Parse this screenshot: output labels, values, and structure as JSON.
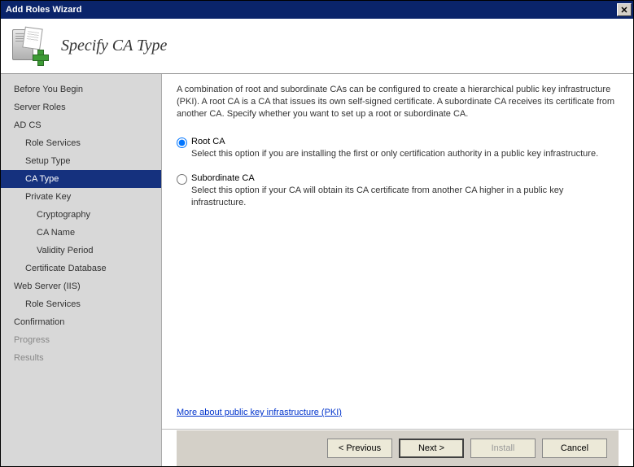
{
  "window": {
    "title": "Add Roles Wizard"
  },
  "header": {
    "title": "Specify CA Type"
  },
  "sidebar": {
    "items": [
      {
        "label": "Before You Begin",
        "level": 0,
        "selected": false
      },
      {
        "label": "Server Roles",
        "level": 0,
        "selected": false
      },
      {
        "label": "AD CS",
        "level": 0,
        "selected": false
      },
      {
        "label": "Role Services",
        "level": 1,
        "selected": false
      },
      {
        "label": "Setup Type",
        "level": 1,
        "selected": false
      },
      {
        "label": "CA Type",
        "level": 1,
        "selected": true
      },
      {
        "label": "Private Key",
        "level": 1,
        "selected": false
      },
      {
        "label": "Cryptography",
        "level": 2,
        "selected": false
      },
      {
        "label": "CA Name",
        "level": 2,
        "selected": false
      },
      {
        "label": "Validity Period",
        "level": 2,
        "selected": false
      },
      {
        "label": "Certificate Database",
        "level": 1,
        "selected": false
      },
      {
        "label": "Web Server (IIS)",
        "level": 0,
        "selected": false
      },
      {
        "label": "Role Services",
        "level": 1,
        "selected": false
      },
      {
        "label": "Confirmation",
        "level": 0,
        "selected": false
      },
      {
        "label": "Progress",
        "level": 0,
        "selected": false,
        "disabled": true
      },
      {
        "label": "Results",
        "level": 0,
        "selected": false,
        "disabled": true
      }
    ]
  },
  "content": {
    "description": "A combination of root and subordinate CAs can be configured to create a hierarchical public key infrastructure (PKI). A root CA is a CA that issues its own self-signed certificate. A subordinate CA receives its certificate from another CA. Specify whether you want to set up a root or subordinate CA.",
    "options": [
      {
        "title": "Root CA",
        "desc": "Select this option if you are installing the first or only certification authority in a public key infrastructure.",
        "checked": true
      },
      {
        "title": "Subordinate CA",
        "desc": "Select this option if your CA will obtain its CA certificate from another CA higher in a public key infrastructure.",
        "checked": false
      }
    ],
    "link": "More about public key infrastructure (PKI)"
  },
  "footer": {
    "previous": "< Previous",
    "next": "Next >",
    "install": "Install",
    "cancel": "Cancel"
  }
}
